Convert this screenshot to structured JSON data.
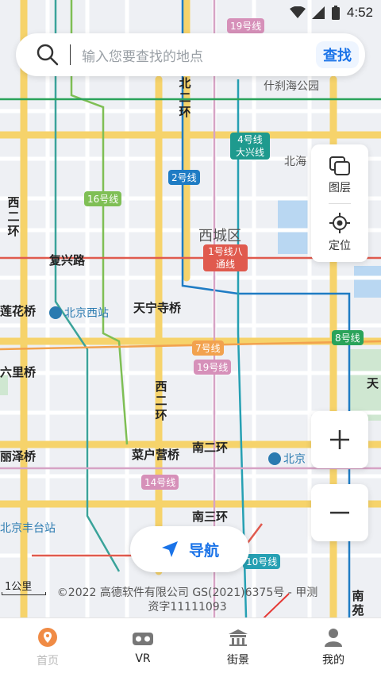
{
  "status_bar": {
    "time": "4:52"
  },
  "search": {
    "placeholder": "输入您要查找的地点",
    "button_label": "查找"
  },
  "side_panel": {
    "layers_label": "图层",
    "locate_label": "定位"
  },
  "navigation": {
    "label": "导航"
  },
  "map": {
    "scale_label": "1公里",
    "copyright": "©2022 高德软件有限公司 GS(2021)6375号 - 甲测资字11111093",
    "roads": [
      "北二环",
      "西二环",
      "复兴路",
      "天宁寺桥",
      "莲花桥",
      "六里桥",
      "丽泽桥",
      "菜户营桥",
      "南二环",
      "南三环",
      "南苑",
      "天"
    ],
    "areas": [
      "西城区",
      "什刹海公园",
      "北海"
    ],
    "metro_lines": [
      "19号线",
      "4号线大兴线",
      "2号线",
      "16号线",
      "1号线八通线",
      "7号线",
      "19号线",
      "8号线",
      "14号线",
      "10号线"
    ],
    "stations": [
      "北京西站",
      "北京",
      "北京丰台站"
    ]
  },
  "tabbar": {
    "items": [
      {
        "label": "首页",
        "icon": "location-pin-icon",
        "active": true
      },
      {
        "label": "VR",
        "icon": "vr-headset-icon",
        "active": false
      },
      {
        "label": "街景",
        "icon": "street-view-icon",
        "active": false
      },
      {
        "label": "我的",
        "icon": "user-icon",
        "active": false
      }
    ]
  },
  "colors": {
    "accent": "#1a73e8",
    "home_icon": "#f08b45",
    "arrow": "#e53935"
  }
}
